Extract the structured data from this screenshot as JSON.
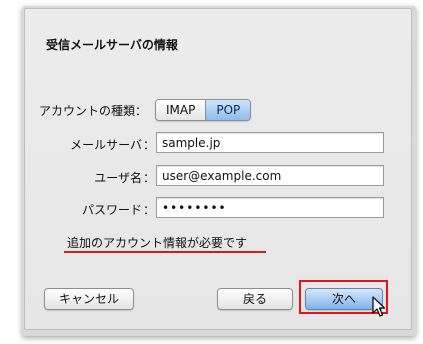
{
  "dialog": {
    "title": "受信メールサーバの情報"
  },
  "account_type": {
    "label": "アカウントの種類：",
    "options": [
      "IMAP",
      "POP"
    ],
    "selected": "POP"
  },
  "mail_server": {
    "label": "メールサーバ",
    "value": "sample.jp"
  },
  "username": {
    "label": "ユーザ名",
    "value": "user@example.com"
  },
  "password": {
    "label": "パスワード",
    "value": "••••••••"
  },
  "colon": "：",
  "notice": "追加のアカウント情報が必要です",
  "buttons": {
    "cancel": "キャンセル",
    "back": "戻る",
    "next": "次へ"
  },
  "colors": {
    "highlight": "#e2141a",
    "selected_segment": "#8fbcec",
    "primary_button": "#7fb2ea"
  }
}
